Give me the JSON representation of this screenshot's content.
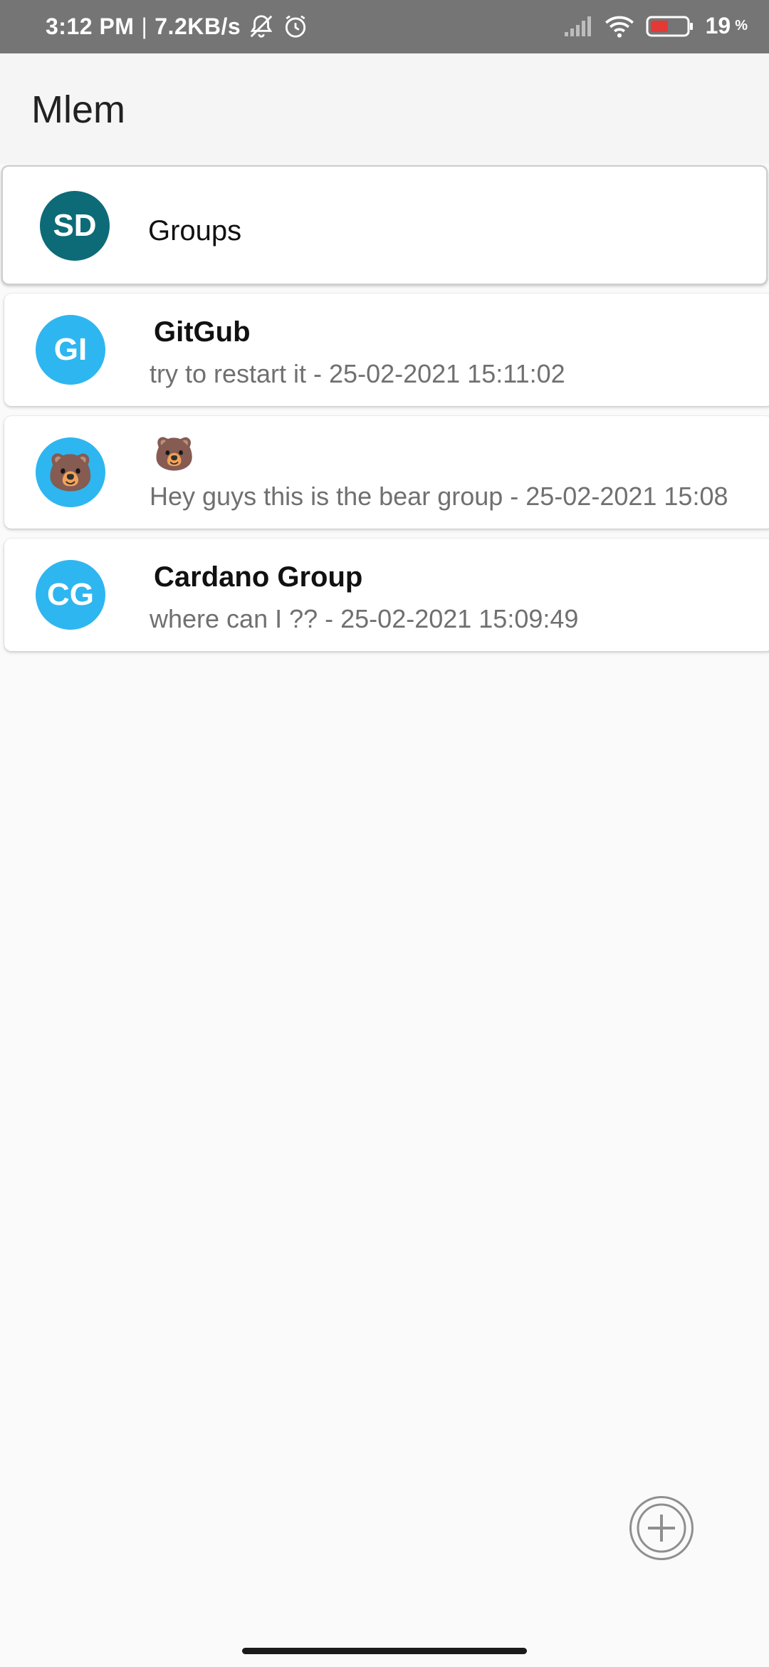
{
  "status_bar": {
    "time": "3:12 PM",
    "separator": "|",
    "speed": "7.2KB/s",
    "battery_percent": "19",
    "battery_symbol": "%",
    "battery_level": 0.19,
    "battery_color": "#e53935",
    "icons": [
      "bell-muted-icon",
      "alarm-icon",
      "cell-signal-icon",
      "wifi-icon",
      "battery-icon"
    ]
  },
  "app_bar": {
    "title": "Mlem"
  },
  "header": {
    "avatar_initials": "SD",
    "label": "Groups",
    "avatar_color": "#0d6b78"
  },
  "groups": [
    {
      "avatar": "GI",
      "name": "GitGub",
      "last_message": "try to restart it  - 25-02-2021 15:11:02"
    },
    {
      "avatar": "🐻",
      "name": "🐻",
      "last_message": "Hey guys this is the bear group  - 25-02-2021 15:08"
    },
    {
      "avatar": "CG",
      "name": "Cardano Group",
      "last_message": "where can I ?? - 25-02-2021 15:09:49"
    }
  ],
  "colors": {
    "avatar_light": "#2eb6f0",
    "status_bar": "#757575",
    "app_bar": "#f5f5f5"
  },
  "fab": {
    "icon": "add-circle-icon"
  }
}
